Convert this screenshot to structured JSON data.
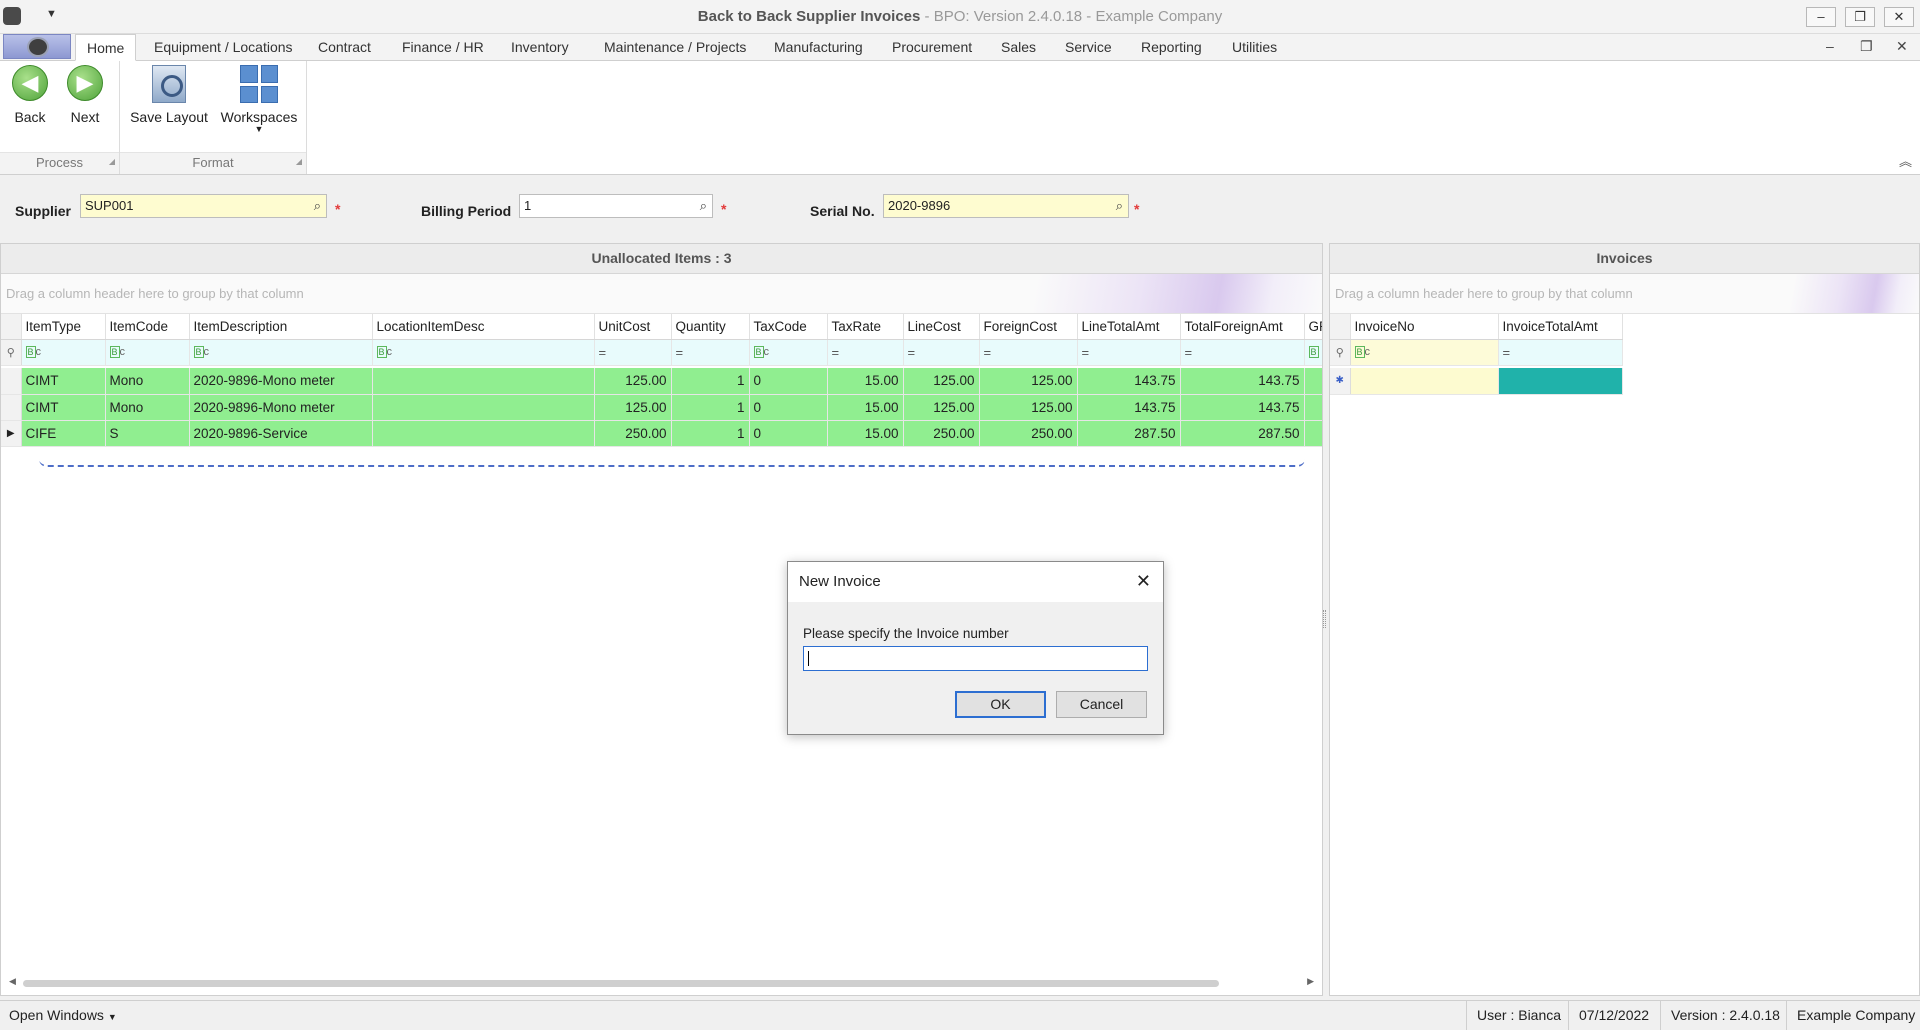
{
  "window": {
    "title": "Back to Back Supplier Invoices",
    "subtitle": "BPO: Version 2.4.0.18 - Example Company"
  },
  "tabs": [
    "Home",
    "Equipment / Locations",
    "Contract",
    "Finance / HR",
    "Inventory",
    "Maintenance / Projects",
    "Manufacturing",
    "Procurement",
    "Sales",
    "Service",
    "Reporting",
    "Utilities"
  ],
  "ribbon": {
    "back": "Back",
    "next": "Next",
    "save_layout": "Save Layout",
    "workspaces": "Workspaces",
    "group_process": "Process",
    "group_format": "Format"
  },
  "filters": {
    "supplier_label": "Supplier",
    "supplier_value": "SUP001",
    "billing_label": "Billing Period",
    "billing_value": "1",
    "serial_label": "Serial No.",
    "serial_value": "2020-9896"
  },
  "left_panel": {
    "title": "Unallocated Items : 3",
    "group_hint": "Drag a column header here to group by that column",
    "columns": [
      "ItemType",
      "ItemCode",
      "ItemDescription",
      "LocationItemDesc",
      "UnitCost",
      "Quantity",
      "TaxCode",
      "TaxRate",
      "LineCost",
      "ForeignCost",
      "LineTotalAmt",
      "TotalForeignAmt",
      "GR"
    ],
    "rows": [
      {
        "ItemType": "CIMT",
        "ItemCode": "Mono",
        "ItemDescription": "2020-9896-Mono meter",
        "LocationItemDesc": "",
        "UnitCost": "125.00",
        "Quantity": "1",
        "TaxCode": "0",
        "TaxRate": "15.00",
        "LineCost": "125.00",
        "ForeignCost": "125.00",
        "LineTotalAmt": "143.75",
        "TotalForeignAmt": "143.75"
      },
      {
        "ItemType": "CIMT",
        "ItemCode": "Mono",
        "ItemDescription": "2020-9896-Mono meter",
        "LocationItemDesc": "",
        "UnitCost": "125.00",
        "Quantity": "1",
        "TaxCode": "0",
        "TaxRate": "15.00",
        "LineCost": "125.00",
        "ForeignCost": "125.00",
        "LineTotalAmt": "143.75",
        "TotalForeignAmt": "143.75"
      },
      {
        "ItemType": "CIFE",
        "ItemCode": "S",
        "ItemDescription": "2020-9896-Service",
        "LocationItemDesc": "",
        "UnitCost": "250.00",
        "Quantity": "1",
        "TaxCode": "0",
        "TaxRate": "15.00",
        "LineCost": "250.00",
        "ForeignCost": "250.00",
        "LineTotalAmt": "287.50",
        "TotalForeignAmt": "287.50"
      }
    ]
  },
  "right_panel": {
    "title": "Invoices",
    "group_hint": "Drag a column header here to group by that column",
    "columns": [
      "InvoiceNo",
      "InvoiceTotalAmt"
    ]
  },
  "dialog": {
    "title": "New Invoice",
    "prompt": "Please specify the Invoice number",
    "value": "",
    "ok": "OK",
    "cancel": "Cancel"
  },
  "status": {
    "open_windows": "Open Windows",
    "user": "User : Bianca",
    "date": "07/12/2022",
    "version": "Version : 2.4.0.18",
    "company": "Example Company"
  },
  "colors": {
    "row_green": "#90ee90",
    "required_yellow": "#fefcd0",
    "invoice_teal": "#20b2aa",
    "accent_blue": "#2c6ed1"
  }
}
